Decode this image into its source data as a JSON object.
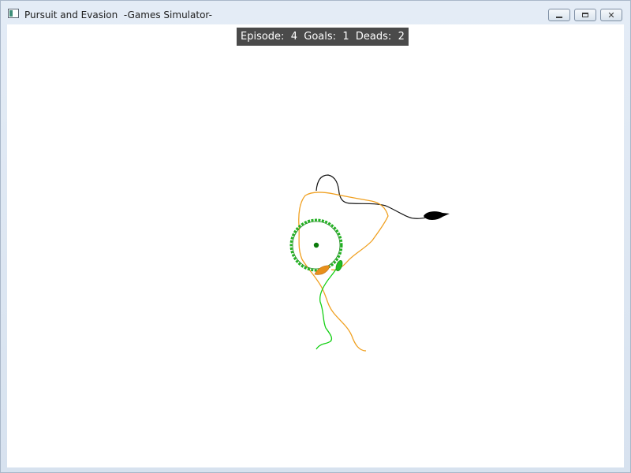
{
  "window": {
    "title": "Pursuit and Evasion  -Games Simulator-",
    "app_icon": "app-window-icon",
    "controls": {
      "minimize_icon": "minimize-icon",
      "maximize_icon": "maximize-icon",
      "close_icon": "close-icon"
    }
  },
  "hud": {
    "episode_label": "Episode:",
    "episode_value": "4",
    "goals_label": "Goals:",
    "goals_value": "1",
    "deads_label": "Deads:",
    "deads_value": "2"
  },
  "colors": {
    "canvas_bg": "#ffffff",
    "hud_bg": "#4a4a4a",
    "goal_ring": "#22b022",
    "goal_center": "#0a7a0a",
    "evader_trail": "#15d015",
    "evader_body": "#22bb22",
    "pursuer_trail": "#f0a020",
    "pursuer_body": "#e8901a",
    "obstacle_trail": "#111111",
    "obstacle_body": "#000000"
  }
}
